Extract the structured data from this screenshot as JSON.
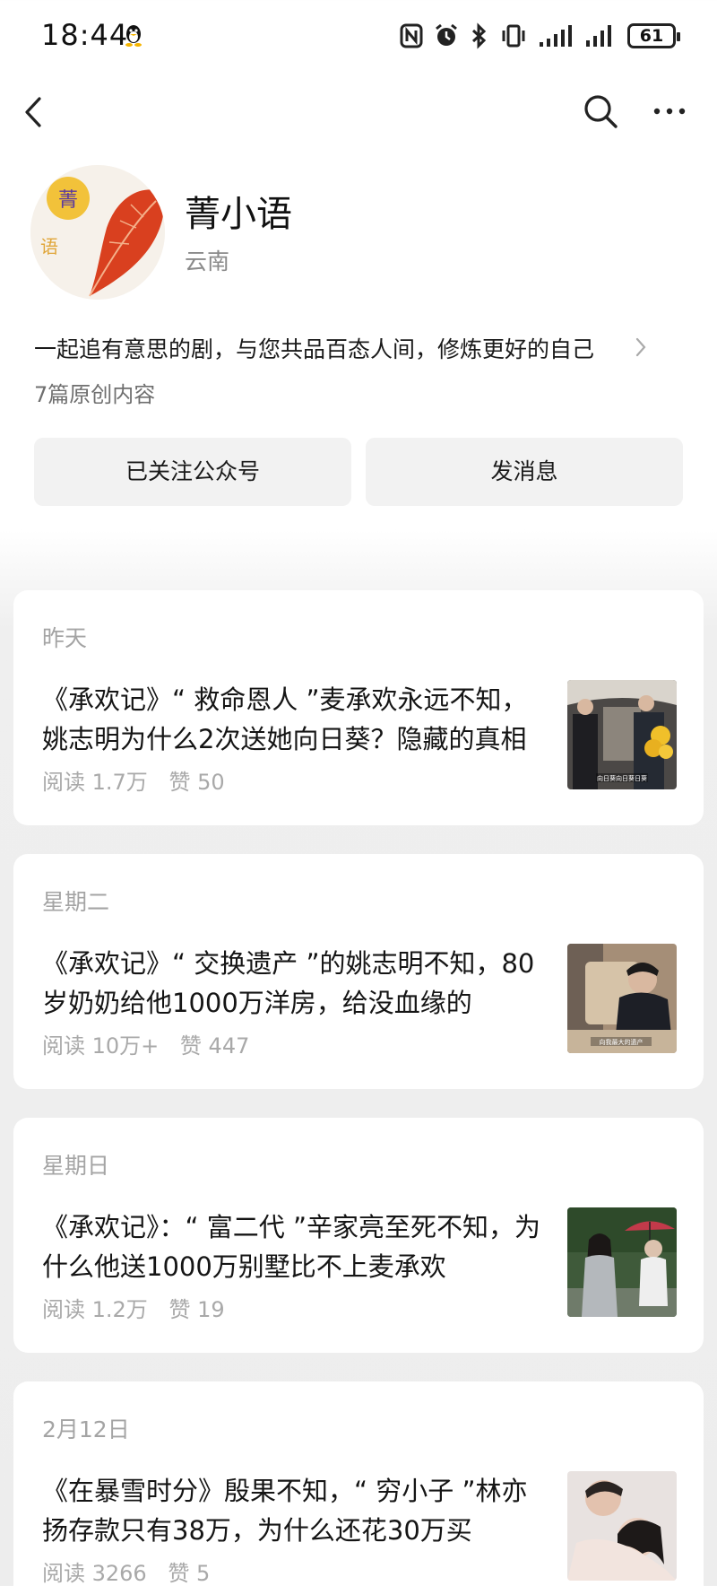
{
  "status_bar": {
    "time": "18:44",
    "battery": "61"
  },
  "nav": {
    "back_icon": "chevron-left-icon",
    "search_icon": "search-icon",
    "more_icon": "more-icon"
  },
  "profile": {
    "name": "菁小语",
    "region": "云南",
    "description": "一起追有意思的剧，与您共品百态人间，修炼更好的自己",
    "original_count": "7篇原创内容",
    "avatar_char_1": "菁",
    "avatar_char_2": "语"
  },
  "actions": {
    "follow_label": "已关注公众号",
    "message_label": "发消息"
  },
  "articles": [
    {
      "date": "昨天",
      "title": "《承欢记》“ 救命恩人 ”麦承欢永远不知，姚志明为什么2次送她向日葵？隐藏的真相",
      "reads": "阅读 1.7万",
      "likes": "赞 50",
      "thumb_caption": "向日葵向日葵日葵"
    },
    {
      "date": "星期二",
      "title": "《承欢记》“ 交换遗产 ”的姚志明不知，80岁奶奶给他1000万洋房，给没血缘的",
      "reads": "阅读 10万+",
      "likes": "赞 447",
      "thumb_caption": "向我最大的遗产"
    },
    {
      "date": "星期日",
      "title": "《承欢记》：“ 富二代 ”辛家亮至死不知，为什么他送1000万别墅比不上麦承欢",
      "reads": "阅读 1.2万",
      "likes": "赞 19"
    },
    {
      "date": "2月12日",
      "title": "《在暴雪时分》殷果不知，“ 穷小子 ”林亦扬存款只有38万，为什么还花30万买",
      "reads": "阅读 3266",
      "likes": "赞 5"
    }
  ],
  "colors": {
    "background_top": "#ffffff",
    "background_list": "#ededed",
    "button_bg": "#f2f2f2",
    "meta_text": "#a9a9a9"
  }
}
